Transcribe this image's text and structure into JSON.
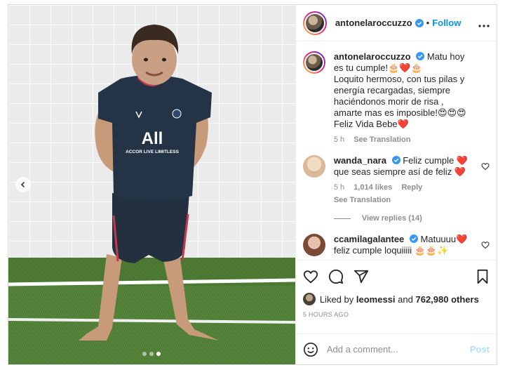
{
  "post": {
    "author": "antonelaroccuzzo",
    "follow_label": "Follow",
    "separator": "•",
    "more_label": "•••",
    "carousel": {
      "total": 3,
      "active_index": 2
    }
  },
  "caption": {
    "username": "antonelaroccuzzo",
    "text_lines": [
      "Matu hoy es tu cumple!🎂❤️🎂",
      "Loquito hermoso, con tus pilas y energía recargadas, siempre haciéndonos morir de risa , amarte mas es imposible!😍😍😍",
      "Feliz Vida Bebe❤️"
    ],
    "age": "5 h",
    "see_translation": "See Translation"
  },
  "comments": [
    {
      "username": "wanda_nara",
      "text": "Feliz cumple ❤️ que seas siempre así de feliz ❤️",
      "age": "5 h",
      "likes": "1,014 likes",
      "reply": "Reply",
      "see_translation": "See Translation",
      "avatar_color": "#e9d3b8"
    },
    {
      "username": "ccamilagalantee",
      "text": "Matuuuu❤️ feliz cumple loquiiiii 🎂🎂✨",
      "avatar_color": "#d9a88e"
    }
  ],
  "view_replies": "View replies (14)",
  "likes_summary": {
    "prefix": "Liked by",
    "user": "leomessi",
    "and": "and",
    "others": "762,980 others"
  },
  "timestamp": "5 HOURS AGO",
  "composer": {
    "placeholder": "Add a comment...",
    "post_label": "Post"
  },
  "colors": {
    "accent": "#0095f6",
    "verified": "#3897f0",
    "post_disabled": "#b2dffc",
    "muted": "#8e8e8e"
  }
}
